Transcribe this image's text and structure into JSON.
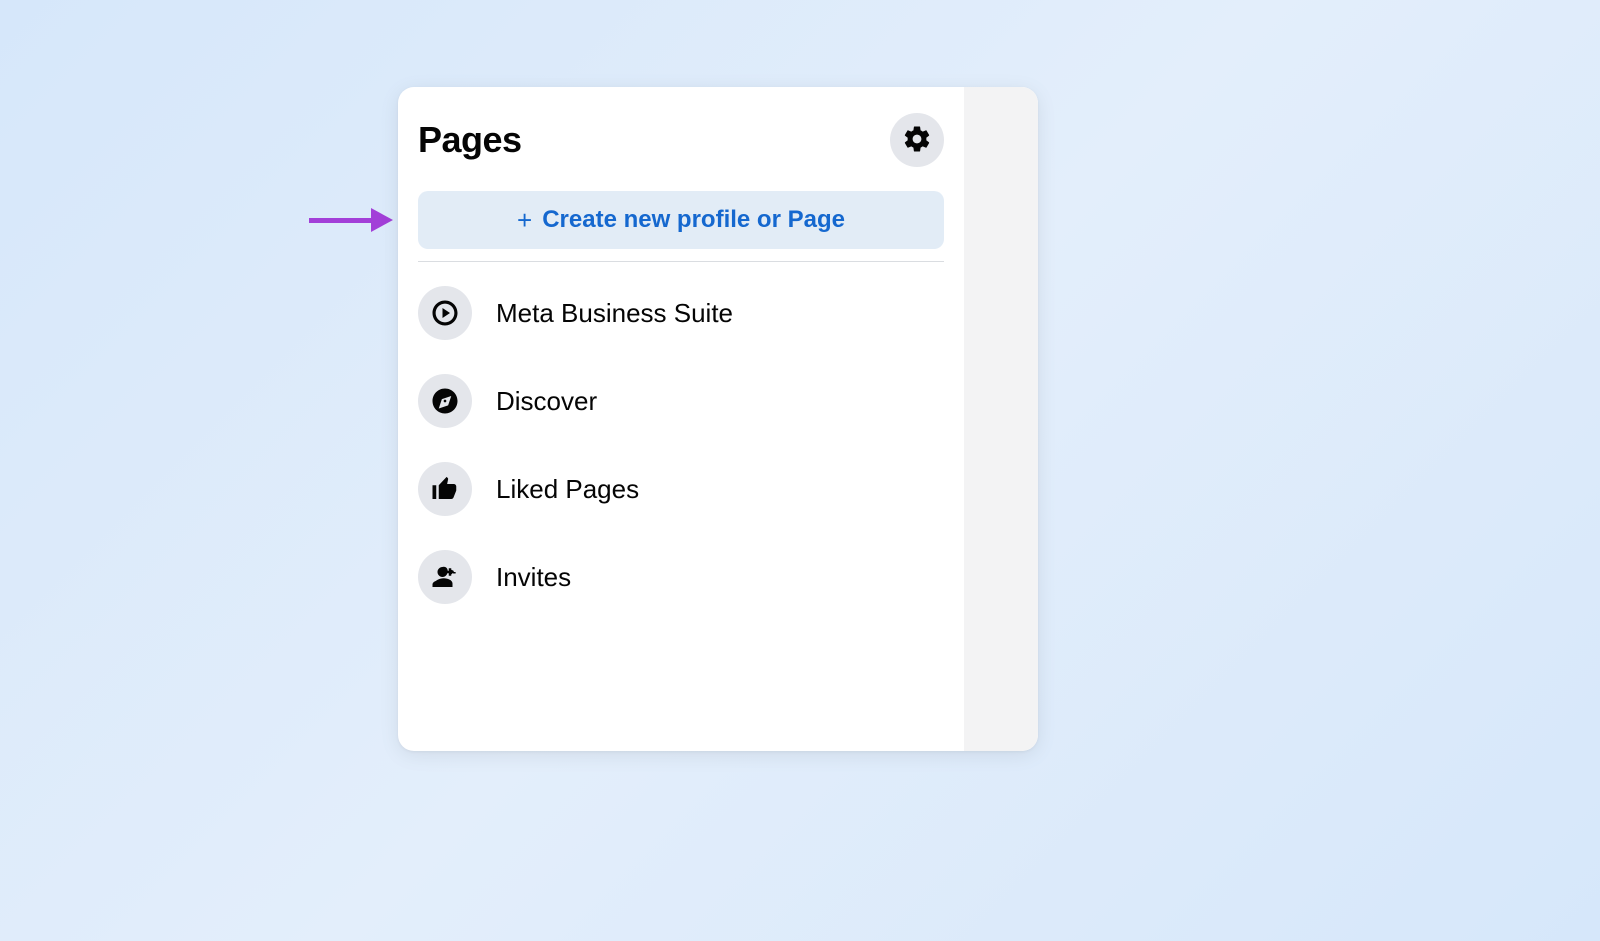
{
  "panel": {
    "title": "Pages",
    "create_button_label": "Create new profile or Page",
    "menu": [
      {
        "label": "Meta Business Suite",
        "icon": "meta-business-icon"
      },
      {
        "label": "Discover",
        "icon": "compass-icon"
      },
      {
        "label": "Liked Pages",
        "icon": "thumbs-up-icon"
      },
      {
        "label": "Invites",
        "icon": "person-plus-icon"
      }
    ]
  },
  "colors": {
    "accent": "#1568cf",
    "annotation": "#a23fd8",
    "icon_bg": "#e4e6eb",
    "create_btn_bg": "#e2ecf6"
  }
}
